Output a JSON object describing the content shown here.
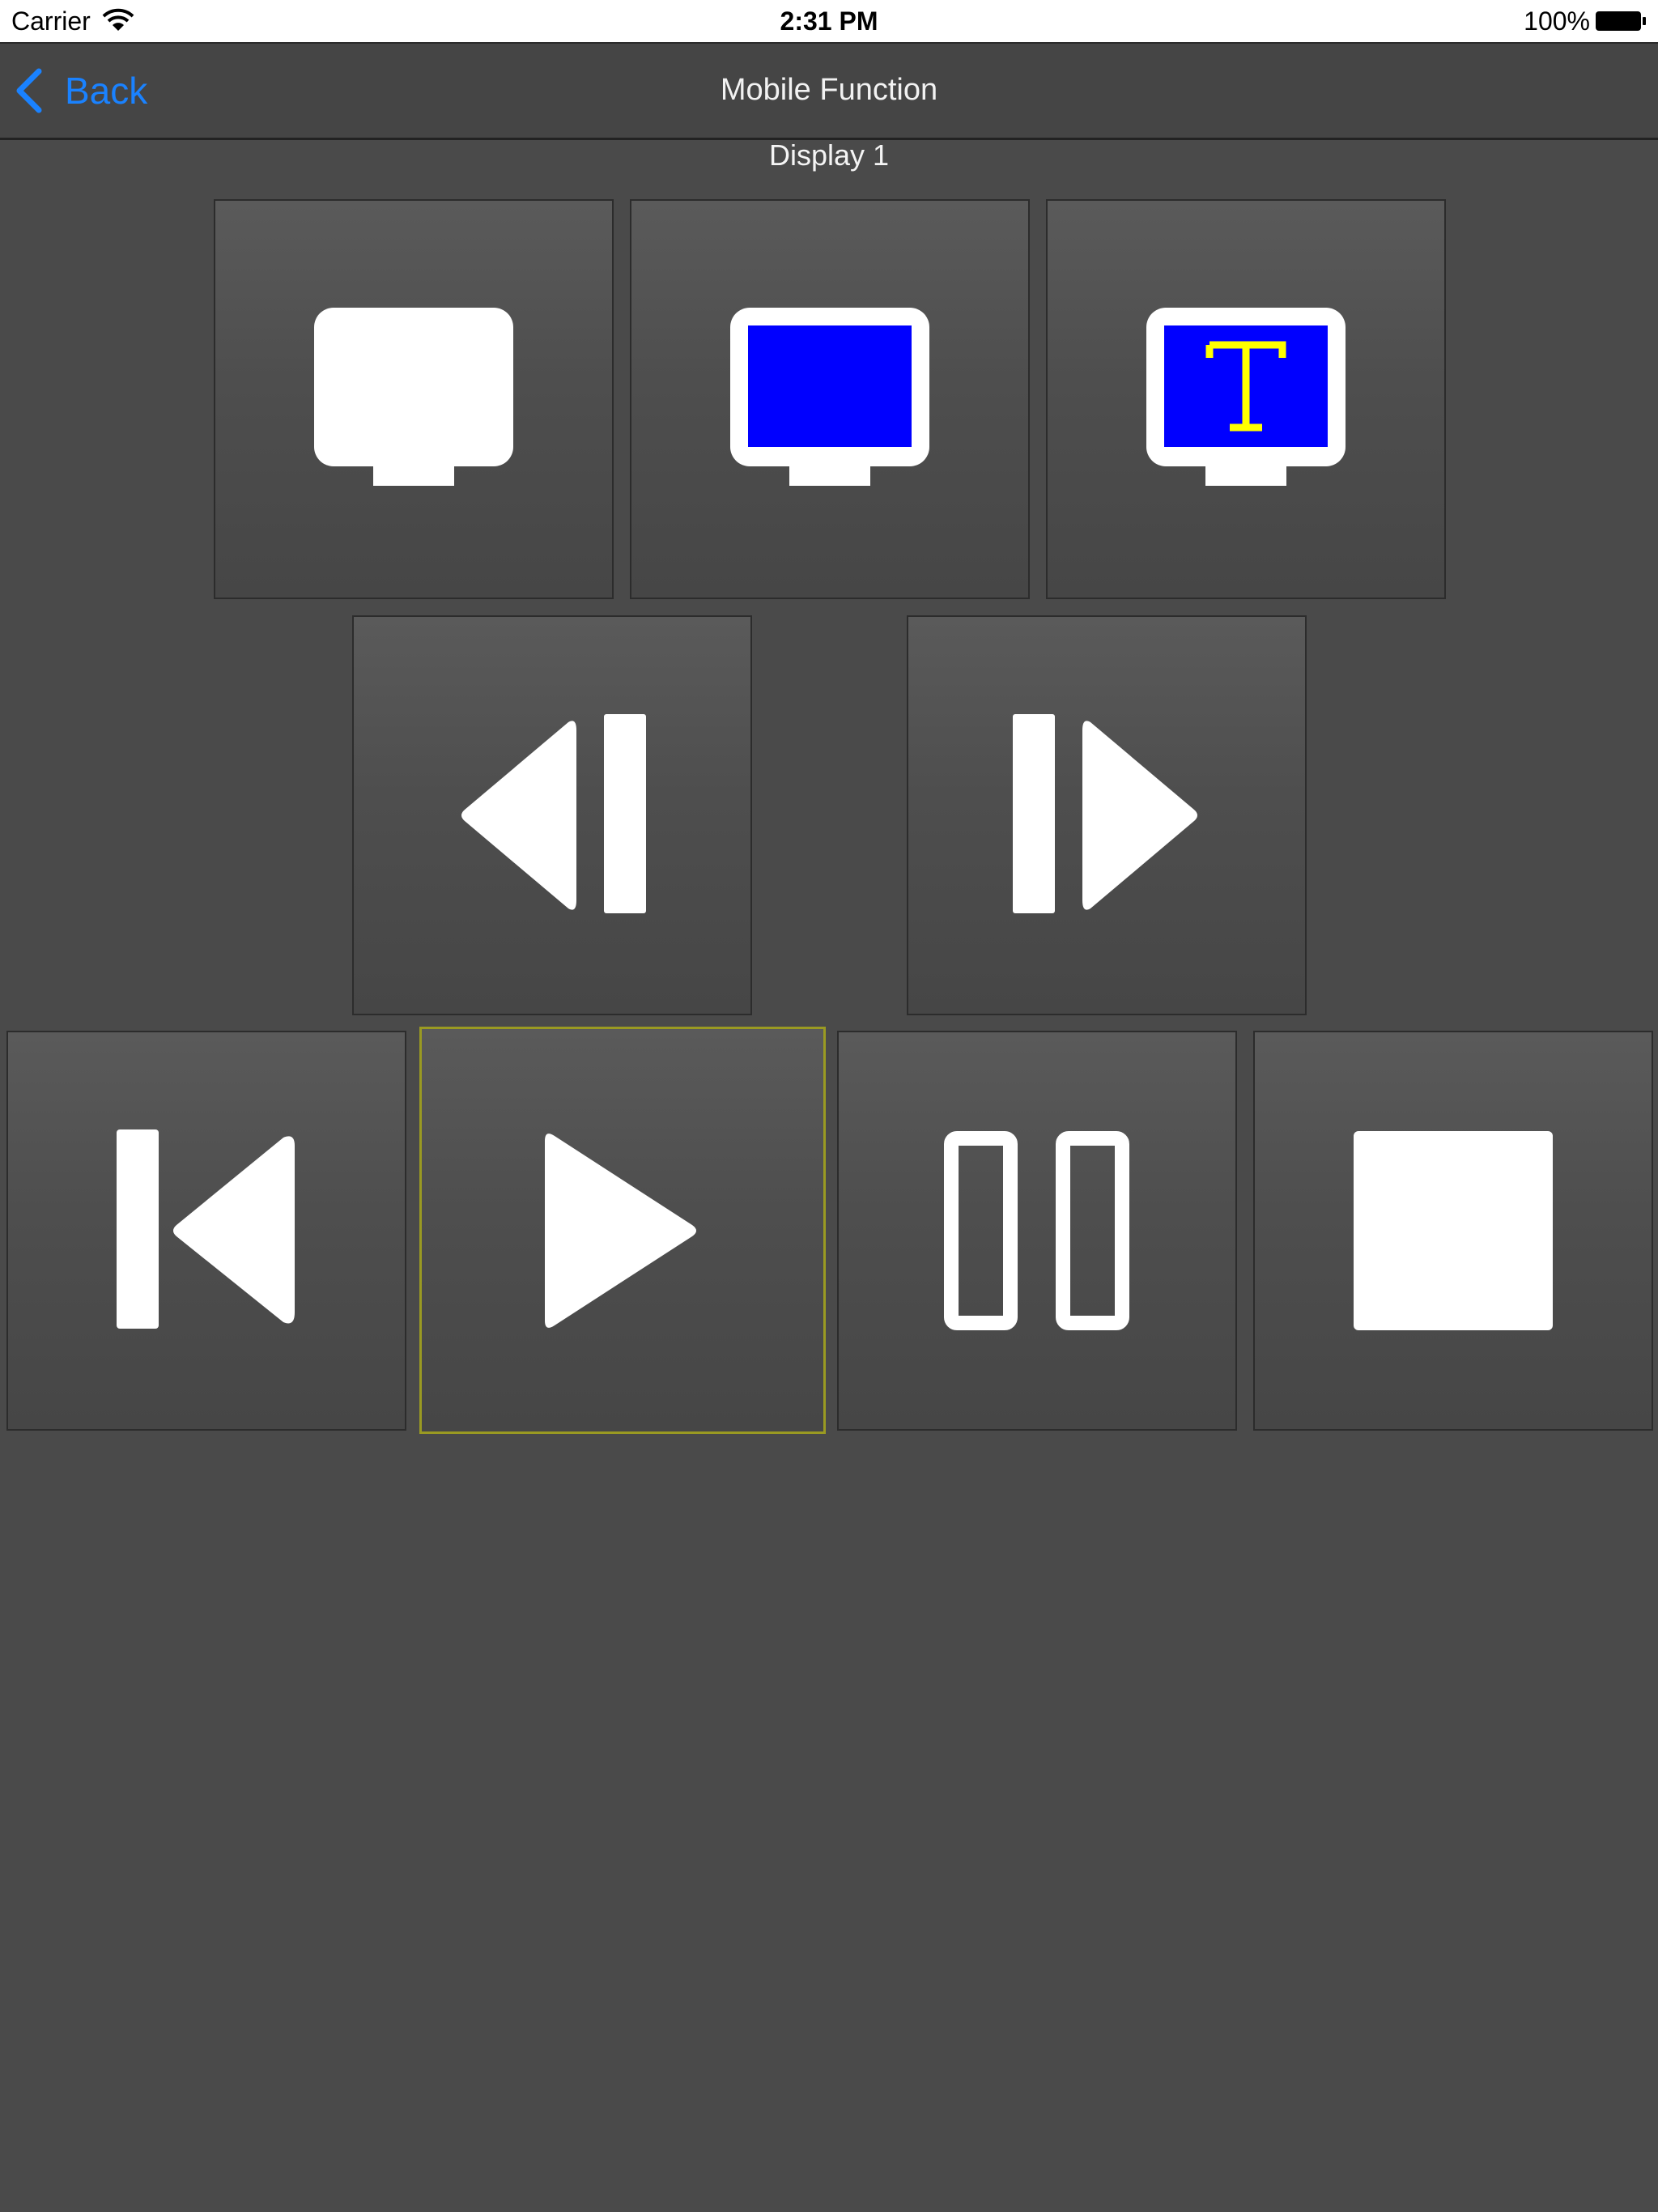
{
  "status_bar": {
    "carrier": "Carrier",
    "time": "2:31 PM",
    "battery": "100%"
  },
  "nav": {
    "back_label": "Back",
    "title": "Mobile Function"
  },
  "main": {
    "section_title": "Display 1",
    "buttons": [
      {
        "name": "display-white-button",
        "icon": "monitor-white-icon"
      },
      {
        "name": "display-blue-button",
        "icon": "monitor-blue-icon"
      },
      {
        "name": "display-text-button",
        "icon": "monitor-text-icon"
      },
      {
        "name": "previous-frame-button",
        "icon": "step-back-icon"
      },
      {
        "name": "next-frame-button",
        "icon": "step-forward-icon"
      },
      {
        "name": "skip-to-start-button",
        "icon": "skip-back-icon"
      },
      {
        "name": "play-button",
        "icon": "play-icon",
        "selected": true
      },
      {
        "name": "pause-button",
        "icon": "pause-icon"
      },
      {
        "name": "stop-button",
        "icon": "stop-icon"
      }
    ]
  },
  "colors": {
    "background": "#4a4a4a",
    "accent": "#1a82ff",
    "screen_blue": "#0000ff",
    "text_yellow": "#ffff00",
    "selected_border": "#9a9a22"
  }
}
